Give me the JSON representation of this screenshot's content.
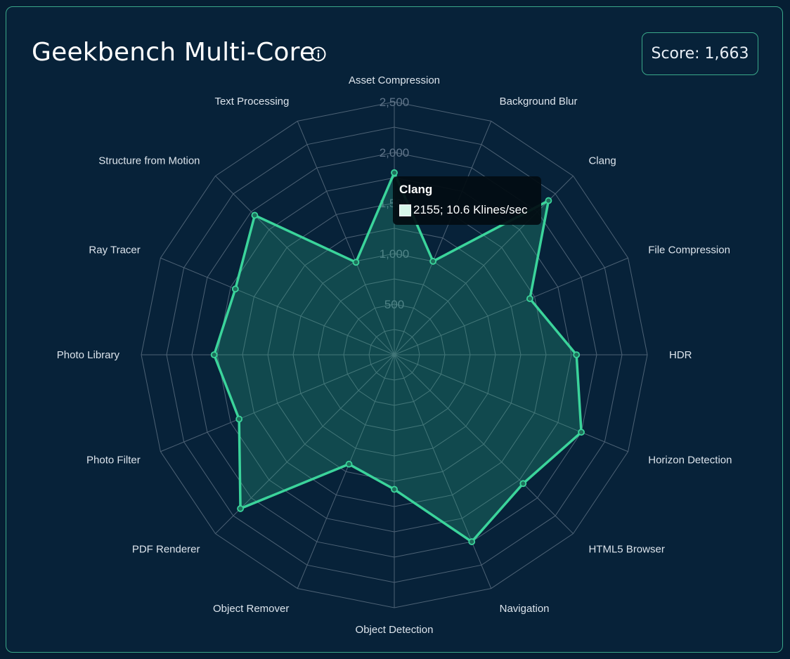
{
  "header": {
    "title": "Geekbench Multi-Core",
    "score_label": "Score: 1,663"
  },
  "icons": {
    "info": "info-circle-icon"
  },
  "colors": {
    "background": "#061e33",
    "card_border": "#3aa88a",
    "series_line": "#3bd49b",
    "series_fill": "rgba(43,167,130,0.30)",
    "grid": "#4d6275",
    "tick_text": "#5f7489",
    "label_text": "#dce4ec"
  },
  "tooltip": {
    "title": "Clang",
    "value_text": "2155; 10.6 Klines/sec"
  },
  "chart_data": {
    "type": "radar",
    "rmax": 2500,
    "ticks": [
      500,
      1000,
      1500,
      2000,
      2500
    ],
    "tick_labels": [
      "500",
      "1,000",
      "1,500",
      "2,000",
      "2,500"
    ],
    "categories": [
      "Asset Compression",
      "Background Blur",
      "Clang",
      "File Compression",
      "HDR",
      "Horizon Detection",
      "HTML5 Browser",
      "Navigation",
      "Object Detection",
      "Object Remover",
      "PDF Renderer",
      "Photo Filter",
      "Photo Library",
      "Ray Tracer",
      "Structure from Motion",
      "Text Processing"
    ],
    "values": [
      1800,
      1000,
      2155,
      1450,
      1800,
      2000,
      1800,
      2000,
      1330,
      1170,
      2150,
      1660,
      1780,
      1700,
      1950,
      990
    ],
    "grid": true,
    "legend": "none"
  }
}
